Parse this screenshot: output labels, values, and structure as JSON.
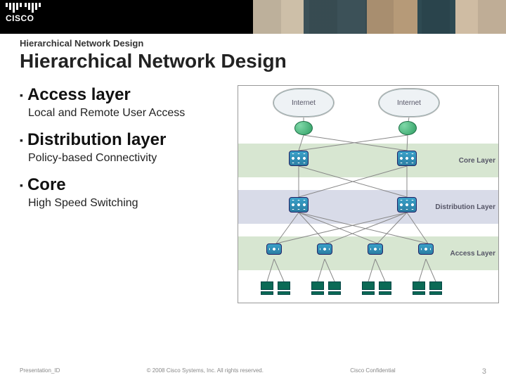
{
  "brand": {
    "name": "CISCO"
  },
  "header": {
    "breadcrumb": "Hierarchical Network Design",
    "title": "Hierarchical Network Design"
  },
  "bullets": [
    {
      "title": "Access layer",
      "sub": "Local and Remote User Access"
    },
    {
      "title": "Distribution layer",
      "sub": "Policy-based Connectivity"
    },
    {
      "title": "Core",
      "sub": "High Speed Switching"
    }
  ],
  "diagram": {
    "clouds": [
      "Internet",
      "Internet"
    ],
    "layers": {
      "core": "Core Layer",
      "distribution": "Distribution Layer",
      "access": "Access Layer"
    }
  },
  "footer": {
    "left": "Presentation_ID",
    "center": "© 2008 Cisco Systems, Inc. All rights reserved.",
    "right": "Cisco Confidential",
    "page": "3"
  }
}
